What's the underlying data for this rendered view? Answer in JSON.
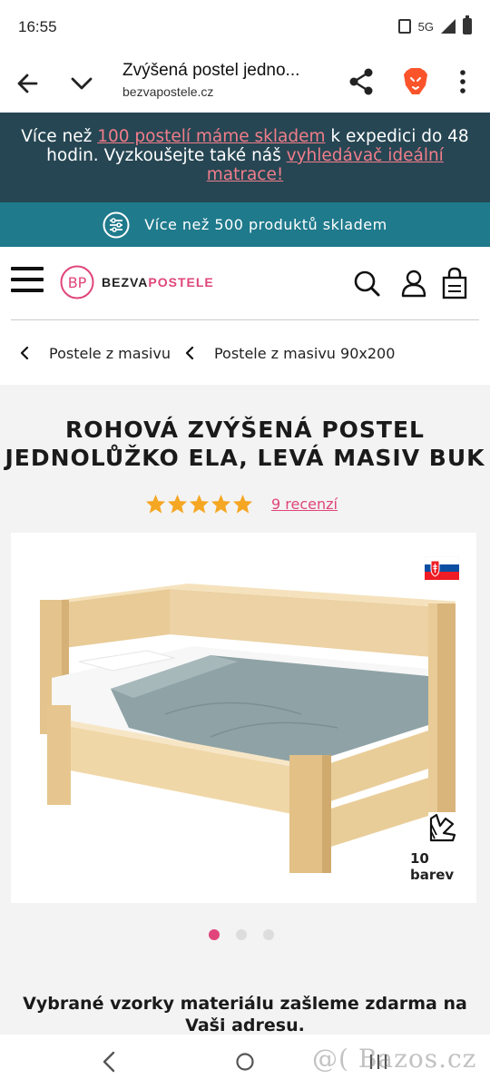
{
  "status_bar": {
    "time": "16:55",
    "network": "5G"
  },
  "browser": {
    "page_title": "Zvýšená postel jedno...",
    "url": "bezvapostele.cz"
  },
  "promo": {
    "text_before": "Více než ",
    "link1": "100 postelí máme skladem",
    "text_middle": " k expedici do 48 hodin. Vyzkoušejte také náš ",
    "link2": "vyhledávač ideální matrace!"
  },
  "stock_bar": {
    "text": "Více než 500 produktů skladem"
  },
  "header": {
    "logo_initials": "BP",
    "logo_part1": "BEZVA",
    "logo_part2": "POSTELE"
  },
  "breadcrumb": [
    "Postele z masivu",
    "Postele z masivu 90x200"
  ],
  "product": {
    "title": "ROHOVÁ ZVÝŠENÁ POSTEL JEDNOLŮŽKO ELA, LEVÁ MASIV BUK",
    "rating": 5,
    "reviews_label": "9 recenzí",
    "colors_label": "10 barev"
  },
  "gallery": {
    "total": 3,
    "active_index": 0
  },
  "samples_text": "Vybrané vzorky materiálu zašleme zdarma na Vaši adresu.",
  "watermark": "@( Bazos.cz",
  "colors": {
    "promo_bg": "#264653",
    "stock_bg": "#1f7a8c",
    "accent": "#e0457b",
    "star": "#f5a623"
  }
}
